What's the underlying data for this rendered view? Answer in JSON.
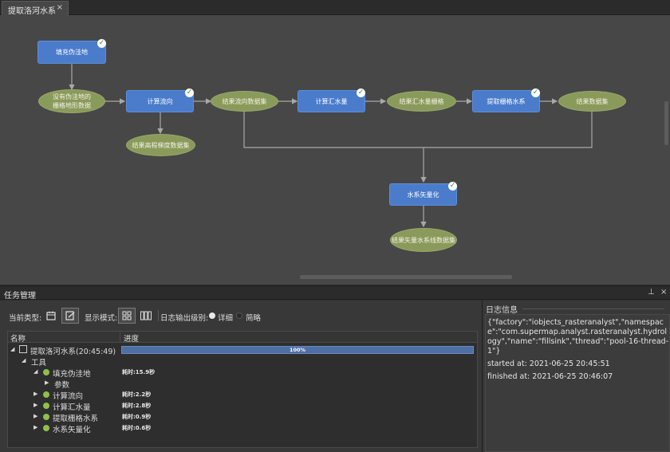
{
  "tab": {
    "title": "提取洛河水系",
    "close": "×"
  },
  "flow": {
    "nodes": {
      "fill_sink": "填充伪洼地",
      "dem_data": "没有伪洼地的\n栅格地形数据",
      "calc_flow_dir": "计算流向",
      "flow_dir_data": "结果流向数据集",
      "calc_accum": "计算汇水量",
      "accum_grid": "结果汇水量栅格",
      "extract_grid": "提取栅格水系",
      "result_data": "结果数据集",
      "slope_data": "结果高程梯度数据集",
      "vectorize": "水系矢量化",
      "vector_data": "结果矢量水系线数据集"
    },
    "check": "✓"
  },
  "task_panel": {
    "title": "任务管理",
    "pin": "⊥",
    "close": "×",
    "toolbar": {
      "current_type_label": "当前类型:",
      "display_mode_label": "显示模式:",
      "log_level_label": "日志输出级别:",
      "detail_label": "详细",
      "brief_label": "简略"
    },
    "grid": {
      "col_name": "名称",
      "col_progress": "进度",
      "workflow": {
        "name": "提取洛河水系(20:45:49)",
        "progress": 100,
        "progress_text": "100%"
      },
      "tools_group": "工具",
      "tasks": [
        {
          "name": "填充伪洼地",
          "time": "耗时:15.9秒"
        },
        {
          "name": "参数",
          "time": ""
        },
        {
          "name": "计算流向",
          "time": "耗时:2.2秒"
        },
        {
          "name": "计算汇水量",
          "time": "耗时:2.8秒"
        },
        {
          "name": "提取栅格水系",
          "time": "耗时:0.9秒"
        },
        {
          "name": "水系矢量化",
          "time": "耗时:0.6秒"
        }
      ]
    }
  },
  "log_panel": {
    "title": "日志信息",
    "json": "{\"factory\":\"iobjects_rasteranalyst\",\"namespace\":\"com.supermap.analyst.rasteranalyst.hydrology\",\"name\":\"fillsink\",\"thread\":\"pool-16-thread-1\"}",
    "started": "started at: 2021-06-25 20:45:51",
    "finished": "finished at: 2021-06-25 20:46:07"
  }
}
